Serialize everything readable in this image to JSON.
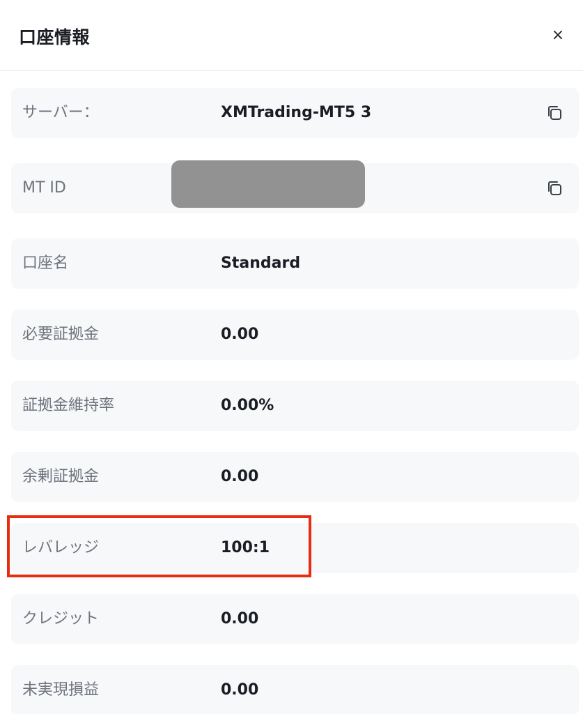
{
  "header": {
    "title": "口座情報",
    "close_label": "×"
  },
  "rows": [
    {
      "label": "サーバー：",
      "value": "XMTrading-MT5 3",
      "copyable": true
    },
    {
      "label": "MT ID",
      "value": "",
      "copyable": true,
      "redacted": true
    },
    {
      "label": "口座名",
      "value": "Standard"
    },
    {
      "label": "必要証拠金",
      "value": "0.00"
    },
    {
      "label": "証拠金維持率",
      "value": "0.00%"
    },
    {
      "label": "余剰証拠金",
      "value": "0.00"
    },
    {
      "label": "レバレッジ",
      "value": "100:1",
      "highlighted": true
    },
    {
      "label": "クレジット",
      "value": "0.00"
    },
    {
      "label": "未実現損益",
      "value": "0.00"
    }
  ],
  "colors": {
    "row_background": "#f7f8fa",
    "highlight_border": "#e82c12",
    "redaction": "#929292"
  },
  "icons": {
    "copy": "copy-icon",
    "close": "close-icon"
  }
}
